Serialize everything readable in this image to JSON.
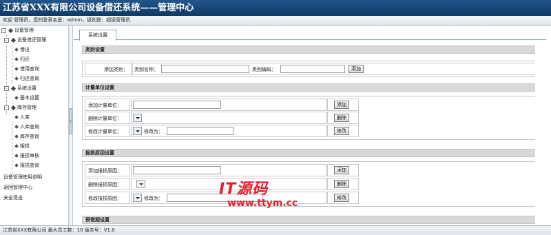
{
  "app": {
    "title": "江苏省XXX有限公司设备借还系统——管理中心"
  },
  "userbar": {
    "text": "欢迎 管理员，您的登录名是：admin，级别是：超级管理员"
  },
  "sidebar": {
    "root": "设备管理",
    "groups": [
      {
        "label": "设备借还管理",
        "items": [
          "借出",
          "归还",
          "借用查询",
          "归还查询"
        ]
      },
      {
        "label": "系统设置",
        "items": [
          "基本设置"
        ]
      },
      {
        "label": "库存管理",
        "items": [
          "入库",
          "入库查询",
          "库存查询",
          "报损",
          "报损审核",
          "报损查询"
        ]
      }
    ],
    "links": [
      "设备管理使用说明",
      "返回管理中心",
      "安全退出"
    ]
  },
  "tabs": [
    "系统设置"
  ],
  "sections": {
    "category": {
      "header": "类别设置",
      "row_label": "添加类别：",
      "name_label": "类别名称：",
      "code_label": "类别编码：",
      "add_button": "添加"
    },
    "unit": {
      "header": "计量单位设置",
      "add_label": "添加计量单位：",
      "delete_label": "删除计量单位：",
      "modify_label": "修改计量单位：",
      "change_to": "修改为：",
      "add_button": "添加",
      "delete_button": "删除",
      "modify_button": "修改"
    },
    "scrap": {
      "header": "报损原因设置",
      "add_label": "添加报损原因：",
      "delete_label": "删除报损原因：",
      "modify_label": "修改报损原因：",
      "change_to": "修改为：",
      "add_button": "添加",
      "delete_button": "删除",
      "modify_button": "修改"
    },
    "borrow_period": {
      "header": "预借期设置"
    }
  },
  "statusbar": {
    "text": "江苏省XXX有限公司 最大员工数：10 版本号：V1.0"
  },
  "watermark": {
    "brand": "IT源码",
    "url": "www.ttym.cc"
  }
}
